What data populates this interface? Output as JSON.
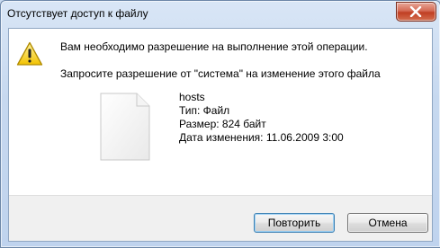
{
  "window": {
    "title": "Отсутствует доступ к файлу"
  },
  "message": {
    "line1": "Вам необходимо разрешение на выполнение этой операции.",
    "line2": "Запросите разрешение от \"система\" на изменение этого файла"
  },
  "file": {
    "name": "hosts",
    "type": "Тип: Файл",
    "size": "Размер: 824 байт",
    "modified": "Дата изменения: 11.06.2009 3:00"
  },
  "buttons": {
    "retry": "Повторить",
    "cancel": "Отмена"
  },
  "icons": {
    "warning": "warning-icon",
    "file": "file-icon",
    "close": "close-icon"
  },
  "colors": {
    "close_button": "#c03e23",
    "warning": "#f2c200"
  }
}
